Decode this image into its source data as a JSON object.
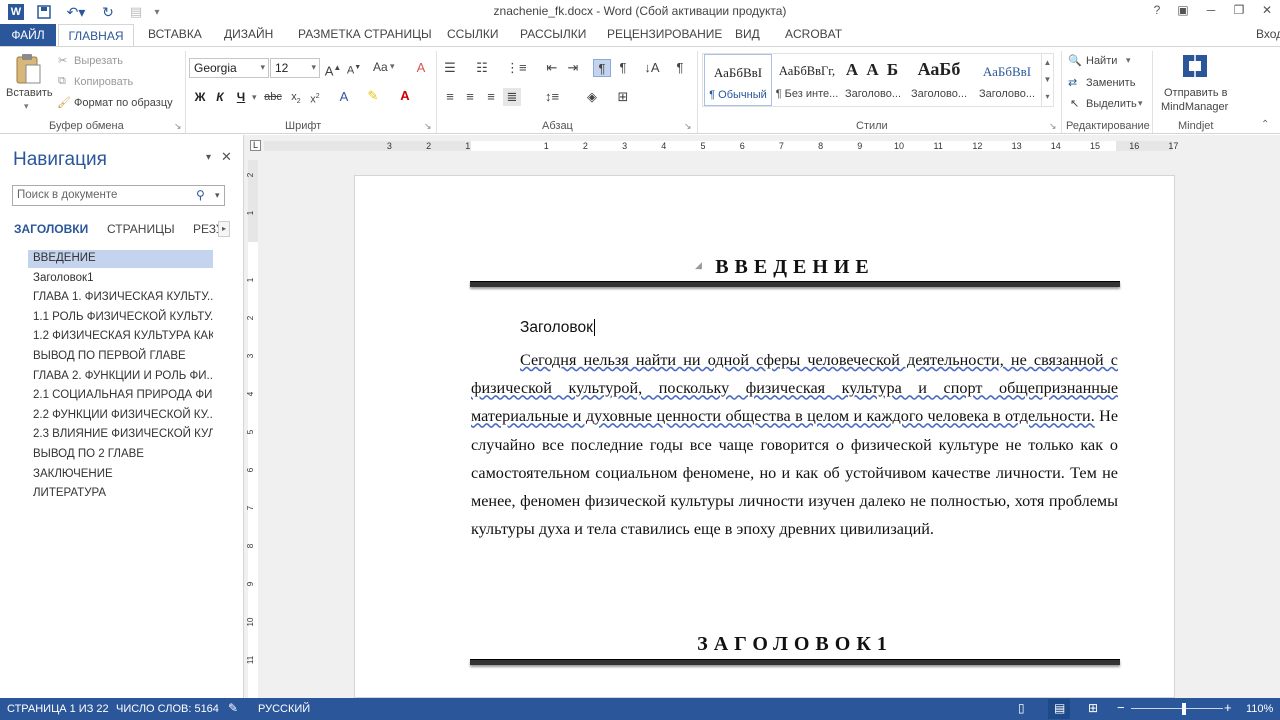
{
  "window": {
    "title": "znachenie_fk.docx - Word (Сбой активации продукта)",
    "sign_in": "Вход"
  },
  "tabs": [
    "ГЛАВНАЯ",
    "ВСТАВКА",
    "ДИЗАЙН",
    "РАЗМЕТКА СТРАНИЦЫ",
    "ССЫЛКИ",
    "РАССЫЛКИ",
    "РЕЦЕНЗИРОВАНИЕ",
    "ВИД",
    "ACROBAT"
  ],
  "file_tab": "ФАЙЛ",
  "clipboard": {
    "paste": "Вставить",
    "cut": "Вырезать",
    "copy": "Копировать",
    "format_painter": "Формат по образцу",
    "label": "Буфер обмена"
  },
  "font": {
    "name": "Georgia",
    "size": "12",
    "label": "Шрифт",
    "bold": "Ж",
    "italic": "К",
    "underline": "Ч",
    "case": "Aa"
  },
  "paragraph": {
    "label": "Абзац"
  },
  "styles": {
    "label": "Стили",
    "items": [
      {
        "preview": "АаБбВвI",
        "name": "¶ Обычный"
      },
      {
        "preview": "АаБбВвГг,",
        "name": "¶ Без инте..."
      },
      {
        "preview": "А А Б",
        "name": "Заголово..."
      },
      {
        "preview": "АаБб",
        "name": "Заголово..."
      },
      {
        "preview": "АаБбВвI",
        "name": "Заголово..."
      }
    ]
  },
  "editing": {
    "find": "Найти",
    "replace": "Заменить",
    "select": "Выделить",
    "label": "Редактирование"
  },
  "mindjet": {
    "send_line1": "Отправить в",
    "send_line2": "MindManager",
    "label": "Mindjet"
  },
  "navigation": {
    "title": "Навигация",
    "search_placeholder": "Поиск в документе",
    "tabs": [
      "ЗАГОЛОВКИ",
      "СТРАНИЦЫ",
      "РЕЗУ"
    ],
    "headings": [
      "ВВЕДЕНИЕ",
      "Заголовок1",
      "ГЛАВА 1. ФИЗИЧЕСКАЯ КУЛЬТУ...",
      "1.1 РОЛЬ ФИЗИЧЕСКОЙ КУЛЬТУ...",
      "1.2 ФИЗИЧЕСКАЯ КУЛЬТУРА КАК...",
      "ВЫВОД ПО ПЕРВОЙ ГЛАВЕ",
      "ГЛАВА 2. ФУНКЦИИ И РОЛЬ ФИ...",
      "2.1 СОЦИАЛЬНАЯ ПРИРОДА ФИ...",
      "2.2 ФУНКЦИИ ФИЗИЧЕСКОЙ КУ...",
      "2.3 ВЛИЯНИЕ ФИЗИЧЕСКОЙ КУЛ...",
      "ВЫВОД ПО 2 ГЛАВЕ",
      "ЗАКЛЮЧЕНИЕ",
      "ЛИТЕРАТУРА"
    ]
  },
  "ruler": {
    "top": [
      "3",
      "2",
      "1",
      "1",
      "2",
      "3",
      "4",
      "5",
      "6",
      "7",
      "8",
      "9",
      "10",
      "11",
      "12",
      "13",
      "14",
      "15",
      "16",
      "17"
    ],
    "left": [
      "2",
      "1",
      "1",
      "2",
      "3",
      "4",
      "5",
      "6",
      "7",
      "8",
      "9",
      "10",
      "11"
    ]
  },
  "document": {
    "heading1": "ВВЕДЕНИЕ",
    "subheading": "Заголовок",
    "para_underlined": "Сегодня нельзя найти ни одной сферы человеческой деятельности, не связанной с физической культурой, поскольку физическая культура и спорт общепризнанные материальные и духовные ценности общества в целом и каждого человека в отдельности.",
    "para_rest": " Не случайно все последние годы все чаще говорится о физической культуре не только как о самостоятельном социальном феномене, но и как об устойчивом качестве личности. Тем не менее, феномен физической культуры личности изучен далеко не полностью, хотя проблемы культуры духа и тела ставились еще в эпоху древних цивилизаций.",
    "heading2": "ЗАГОЛОВОК1"
  },
  "status": {
    "page": "СТРАНИЦА 1 ИЗ 22",
    "words": "ЧИСЛО СЛОВ: 5164",
    "lang": "РУССКИЙ",
    "zoom": "110%",
    "zoom_level": 0.58
  },
  "colors": {
    "accent": "#2b579a",
    "selected": "#c5d4ee"
  }
}
